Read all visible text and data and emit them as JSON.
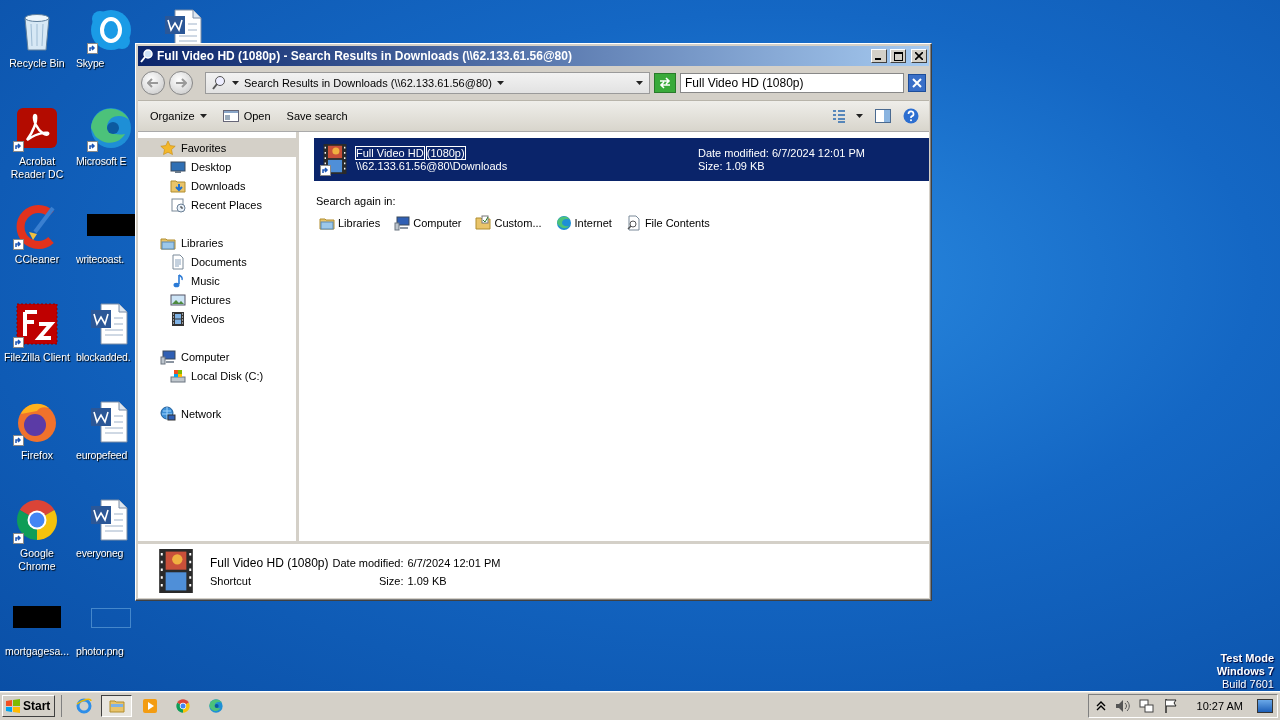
{
  "desktop": {
    "icons": [
      {
        "label": "Recycle Bin",
        "kind": "recycle",
        "shortcut": false
      },
      {
        "label": "Acrobat Reader DC",
        "kind": "acrobat",
        "shortcut": true
      },
      {
        "label": "CCleaner",
        "kind": "ccleaner",
        "shortcut": true
      },
      {
        "label": "FileZilla Client",
        "kind": "filezilla",
        "shortcut": true
      },
      {
        "label": "Firefox",
        "kind": "firefox",
        "shortcut": true
      },
      {
        "label": "Google Chrome",
        "kind": "chrome",
        "shortcut": true
      },
      {
        "label": "mortgagesa...",
        "kind": "redacted",
        "shortcut": false
      },
      {
        "label": "Skype",
        "kind": "skype",
        "shortcut": true
      },
      {
        "label": "Microsoft E",
        "kind": "edge",
        "shortcut": true
      },
      {
        "label": "writecoast.",
        "kind": "redacted",
        "shortcut": false
      },
      {
        "label": "blockadded.",
        "kind": "word",
        "shortcut": false
      },
      {
        "label": "europefeed",
        "kind": "word",
        "shortcut": false
      },
      {
        "label": "everyoneg",
        "kind": "word",
        "shortcut": false
      },
      {
        "label": "photor.png",
        "kind": "blank",
        "shortcut": false
      },
      {
        "kind": "word",
        "shortcut": false
      }
    ],
    "system_text": [
      "Test Mode",
      "Windows 7",
      "Build 7601"
    ]
  },
  "window": {
    "title": "Full Video HD (1080p) - Search Results in Downloads (\\\\62.133.61.56@80)",
    "address": {
      "text": "Search Results in Downloads (\\\\62.133.61.56@80)"
    },
    "search": {
      "value": "Full Video HD (1080p)"
    },
    "toolbar": [
      {
        "label": "Organize",
        "kind": "menu"
      },
      {
        "label": "Open",
        "kind": "open"
      },
      {
        "label": "Save search",
        "kind": "plain"
      }
    ],
    "nav_pane": [
      {
        "label": "Favorites",
        "kind": "favorites",
        "selected": true,
        "children": [
          {
            "label": "Desktop",
            "kind": "desktop",
            "selected": false
          },
          {
            "label": "Downloads",
            "kind": "downloads",
            "selected": false
          },
          {
            "label": "Recent Places",
            "kind": "recent",
            "selected": false
          }
        ]
      },
      {
        "label": "Libraries",
        "kind": "libraries",
        "selected": false,
        "children": [
          {
            "label": "Documents",
            "kind": "documents",
            "selected": false
          },
          {
            "label": "Music",
            "kind": "music",
            "selected": false
          },
          {
            "label": "Pictures",
            "kind": "pictures",
            "selected": false
          },
          {
            "label": "Videos",
            "kind": "videos",
            "selected": false
          }
        ]
      },
      {
        "label": "Computer",
        "kind": "computer",
        "selected": false,
        "children": [
          {
            "label": "Local Disk (C:)",
            "kind": "disk",
            "selected": false
          }
        ]
      },
      {
        "label": "Network",
        "kind": "network",
        "selected": false
      }
    ],
    "results": [
      {
        "selected": true,
        "name_parts": [
          {
            "text": "Full Video HD",
            "highlighted": true
          },
          {
            "text": "(1080p)",
            "highlighted": true
          }
        ],
        "path": "\\\\62.133.61.56@80\\Downloads",
        "date": "Date modified: 6/7/2024 12:01 PM",
        "size": "Size: 1.09 KB"
      }
    ],
    "search_again": {
      "label": "Search again in:",
      "options": [
        {
          "label": "Libraries",
          "kind": "libraries"
        },
        {
          "label": "Computer",
          "kind": "computer"
        },
        {
          "label": "Custom...",
          "kind": "custom"
        },
        {
          "label": "Internet",
          "kind": "internet"
        },
        {
          "label": "File Contents",
          "kind": "contents"
        }
      ]
    },
    "details": {
      "name": "Full Video HD (1080p)",
      "type": "Shortcut",
      "date_label": "Date modified:",
      "date": "6/7/2024 12:01 PM",
      "size_label": "Size:",
      "size": "1.09 KB"
    }
  },
  "taskbar": {
    "start": "Start",
    "apps": [
      {
        "kind": "ie",
        "active": false
      },
      {
        "kind": "explorer",
        "active": true
      },
      {
        "kind": "media",
        "active": false
      },
      {
        "kind": "chrome",
        "active": false
      },
      {
        "kind": "edge",
        "active": false
      }
    ],
    "tray": [
      {
        "kind": "arrow"
      },
      {
        "kind": "speaker"
      },
      {
        "kind": "network"
      },
      {
        "kind": "flag"
      }
    ],
    "clock": "10:27 AM"
  }
}
